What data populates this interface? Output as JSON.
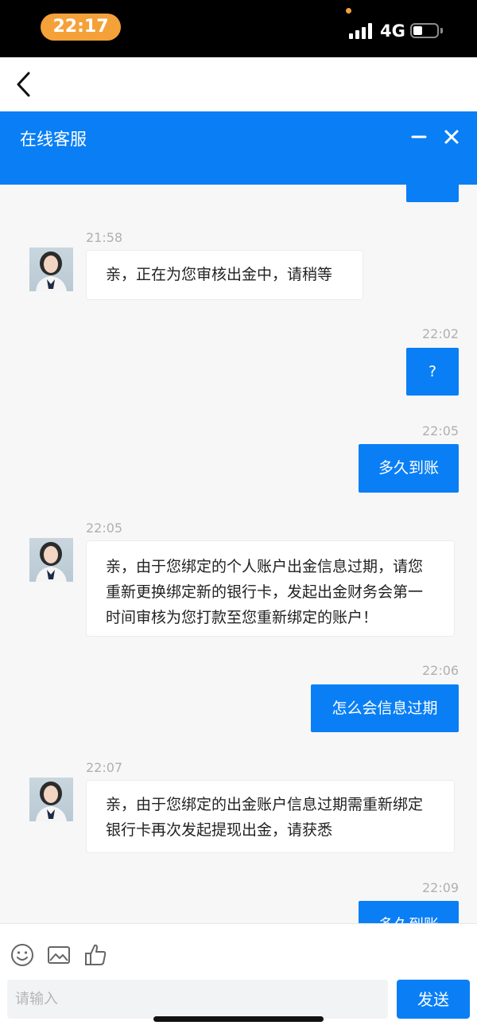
{
  "status_bar": {
    "time": "22:17",
    "network": "4G"
  },
  "header": {
    "title": "在线客服"
  },
  "messages": [
    {
      "from": "user",
      "time": "",
      "text": ""
    },
    {
      "from": "agent",
      "time": "21:58",
      "text": "亲，正在为您审核出金中，请稍等"
    },
    {
      "from": "user",
      "time": "22:02",
      "text": "?"
    },
    {
      "from": "user",
      "time": "22:05",
      "text": "多久到账"
    },
    {
      "from": "agent",
      "time": "22:05",
      "text": "亲，由于您绑定的个人账户出金信息过期，请您重新更换绑定新的银行卡，发起出金财务会第一时间审核为您打款至您重新绑定的账户！"
    },
    {
      "from": "user",
      "time": "22:06",
      "text": "怎么会信息过期"
    },
    {
      "from": "agent",
      "time": "22:07",
      "text": "亲，由于您绑定的出金账户信息过期需重新绑定银行卡再次发起提现出金，请获悉"
    },
    {
      "from": "user",
      "time": "22:09",
      "text": "多久到账"
    }
  ],
  "input": {
    "placeholder": "请输入",
    "send_label": "发送"
  },
  "icons": [
    "back-icon",
    "minimize-icon",
    "close-icon",
    "emoji-icon",
    "image-icon",
    "thumbs-up-icon",
    "avatar"
  ],
  "colors": {
    "accent": "#0a7ff5",
    "time_pill": "#f4a13a"
  }
}
